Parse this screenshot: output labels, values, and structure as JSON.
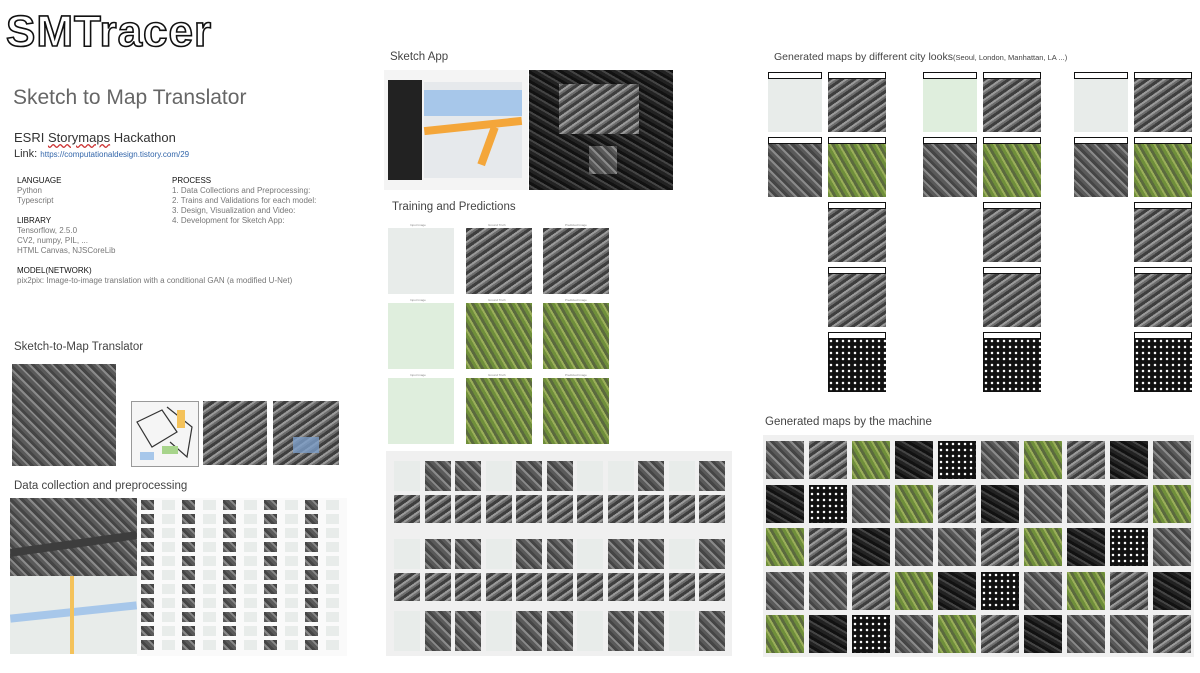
{
  "header": {
    "logo": "SMTracer",
    "title": "Sketch to Map Translator",
    "event_prefix": "ESRI ",
    "event_wavy": "Storymaps",
    "event_suffix": " Hackathon",
    "link_label": "Link: ",
    "link_url": "https://computationaldesign.tistory.com/29"
  },
  "info": {
    "language_h": "LANGUAGE",
    "language": "Python\nTypescript",
    "library_h": "LIBRARY",
    "library": "Tensorflow, 2.5.0\nCV2, numpy, PIL, ...\nHTML Canvas, NJSCoreLib",
    "model_h": "MODEL(NETWORK)",
    "model": "pix2pix: Image-to-image translation with a conditional GAN (a modified U-Net)",
    "process_h": "PROCESS",
    "process": "1. Data Collections and Preprocessing:\n2. Trains and Validations for each model:\n3. Design, Visualization and Video:\n4. Development for Sketch App:"
  },
  "sections": {
    "sketch_to_map": "Sketch-to-Map Translator",
    "data_collection": "Data collection and preprocessing",
    "sketch_app": "Sketch App",
    "training": "Training and Predictions",
    "generated_city": "Generated maps by different city looks",
    "generated_city_small": "(Seoul, London, Manhattan, LA ...)",
    "generated_machine": "Generated maps by the machine"
  },
  "training_labels": {
    "input": "Input Image",
    "truth": "Ground Truth",
    "predicted": "Predicted Image"
  },
  "colors": {
    "road_orange": "#f4a63a",
    "water_blue": "#a7c7ea",
    "park_green": "#cfe8c6"
  }
}
